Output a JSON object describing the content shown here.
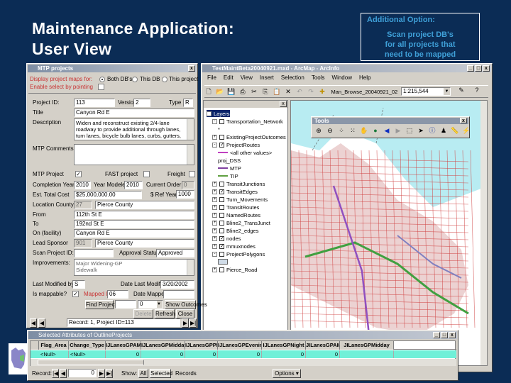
{
  "slide": {
    "title_line1": "Maintenance Application:",
    "title_line2": "User View",
    "callout_heading": "Additional Option:",
    "callout_line1": "Scan project DB's",
    "callout_line2": "for all projects that",
    "callout_line3": "need to be mapped"
  },
  "mtp_dialog": {
    "title": "MTP projects",
    "close": "x",
    "display_label": "Display project maps for:",
    "radio_both": "Both DB's",
    "radio_this_db": "This DB",
    "radio_this_project": "This project",
    "enable_select_label": "Enable select by pointing",
    "project_id_label": "Project ID:",
    "project_id": "113",
    "version_label": "Version",
    "version": "2",
    "type_label": "Type",
    "type": "R",
    "title_label": "Title",
    "title_value": "Canyon Rd E",
    "description_label": "Description",
    "description": "Widen and reconstruct existing 2/4-lane roadway to provide additional through lanes, turn lanes, bicycle bulb lanes, curbs, gutters, and sidewalks; signal",
    "comments_label": "MTP Comments",
    "comments": "",
    "mtp_project_label": "MTP Project",
    "fast_project_label": "FAST project",
    "freight_label": "Freight",
    "completion_year_label": "Completion Year",
    "completion_year": "2010",
    "year_modeled_label": "Year Modeled",
    "year_modeled": "2010",
    "current_order_label": "Current Order",
    "current_order": "0",
    "est_cost_label": "Est. Total Cost",
    "est_cost": "$25,000,000.00",
    "ref_year_label": "$ Ref Year",
    "ref_year": "1000",
    "county_label": "Location County",
    "county_code": "27",
    "county_name": "Pierce County",
    "from_label": "From",
    "from": "112th St E",
    "to_label": "To",
    "to": "192nd St E",
    "on_label": "On (facility)",
    "on": "Canyon Rd E",
    "sponsor_label": "Lead Sponsor",
    "sponsor_code": "901",
    "sponsor_name": "Pierce County",
    "scan_id_label": "Scan Project ID:",
    "scan_id": "",
    "approval_label": "Approval Status",
    "approval": "Approved",
    "improvements_label": "Improvements:",
    "improvement_1": "Major Widening-GP",
    "improvement_2": "Sidewalk",
    "last_modified_by_label": "Last Modified by",
    "last_modified_by": "S",
    "date_modified_label": "Date Last Modified",
    "date_modified": "3/20/2002",
    "mappable_label": "Is mappable?",
    "mapped_id_label": "Mapped ID",
    "mapped_id": "06",
    "date_mapped_label": "Date Mapped",
    "date_mapped": "",
    "find_project": "Find Project",
    "combo_value": "0",
    "show_outcomes": "Show Outcomes",
    "delete": "Delete",
    "refresh": "Refresh",
    "close_btn": "Close",
    "record_text": "Record: 1, Project ID=113"
  },
  "arcmap": {
    "title": "TestMaintBeta20040921.mxd - ArcMap - ArcInfo",
    "menu": [
      "File",
      "Edit",
      "View",
      "Insert",
      "Selection",
      "Tools",
      "Window",
      "Help"
    ],
    "layer_name": "Man_Browse_20040921_02",
    "scale": "1:215,544",
    "toc": [
      {
        "label": "Layers",
        "level": 0,
        "exp": "-",
        "chk": ""
      },
      {
        "label": "Transportation_Network",
        "level": 1,
        "exp": "-",
        "chk": " "
      },
      {
        "label": "*",
        "level": 2,
        "exp": "",
        "chk": ""
      },
      {
        "label": "ExistingProjectOutcomes",
        "level": 1,
        "exp": "+",
        "chk": " "
      },
      {
        "label": "ProjectRoutes",
        "level": 1,
        "exp": "-",
        "chk": "✓"
      },
      {
        "label": "<all other values>",
        "level": 2,
        "exp": "",
        "chk": "",
        "sw": "#c040c0"
      },
      {
        "label": "proj_DSS",
        "level": 2,
        "exp": "",
        "chk": ""
      },
      {
        "label": "MTP",
        "level": 2,
        "exp": "",
        "chk": "",
        "sw": "#8040a0"
      },
      {
        "label": "TIP",
        "level": 2,
        "exp": "",
        "chk": "",
        "sw": "#60a040"
      },
      {
        "label": "TransitJunctions",
        "level": 1,
        "exp": "+",
        "chk": " "
      },
      {
        "label": "TransitEdges",
        "level": 1,
        "exp": "+",
        "chk": "✓"
      },
      {
        "label": "Turn_Movements",
        "level": 1,
        "exp": "+",
        "chk": " "
      },
      {
        "label": "TransitRoutes",
        "level": 1,
        "exp": "+",
        "chk": " "
      },
      {
        "label": "NamedRoutes",
        "level": 1,
        "exp": "+",
        "chk": " "
      },
      {
        "label": "Bline2_TransJunct",
        "level": 1,
        "exp": "+",
        "chk": " "
      },
      {
        "label": "Bline2_edges",
        "level": 1,
        "exp": "+",
        "chk": " "
      },
      {
        "label": "nodes",
        "level": 1,
        "exp": "+",
        "chk": "✓"
      },
      {
        "label": "mmuxnodes",
        "level": 1,
        "exp": "+",
        "chk": "✓"
      },
      {
        "label": "ProjectPolygons",
        "level": 1,
        "exp": "-",
        "chk": " "
      },
      {
        "label": "",
        "level": 2,
        "exp": "",
        "chk": "",
        "sw": "#d0dce8"
      },
      {
        "label": "Pierce_Road",
        "level": 1,
        "exp": "+",
        "chk": " "
      }
    ],
    "tools_title": "Tools"
  },
  "attr_table": {
    "title": "Selected Attributes of OutlineProjects",
    "columns": [
      "Flag_Area",
      "Change_Type",
      "IJLanesGPAM",
      "IJLanesGPMidday",
      "IJLanesGPPM",
      "IJLanesGPEvening",
      "IJLanesGPNight",
      "JILanesGPAM",
      "JILanesGPMidday"
    ],
    "row": [
      "<Null>",
      "<Null>",
      "0",
      "0",
      "0",
      "0",
      "0",
      "0",
      ""
    ],
    "record_label": "Record:",
    "record_value": "0",
    "show_label": "Show:",
    "all": "All",
    "selected": "Selected",
    "records": "Records",
    "options": "Options"
  },
  "colors": {
    "background": "#0b2c55",
    "row_highlight": "#70f0d8",
    "callout_text": "#3fa0d8"
  }
}
